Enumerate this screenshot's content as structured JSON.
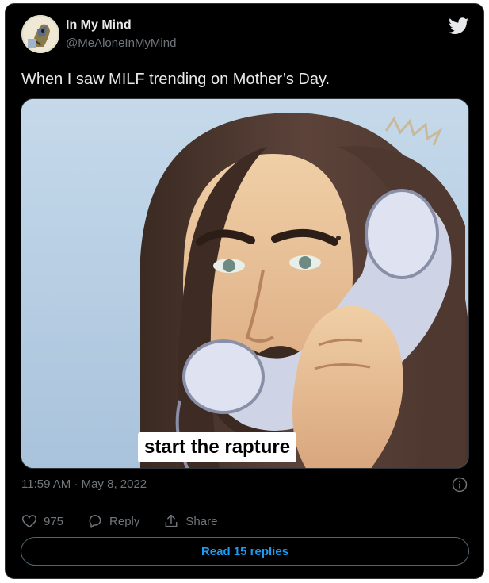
{
  "author": {
    "display_name": "In My Mind",
    "handle": "@MeAloneInMyMind",
    "avatar_icon": "cartoon-avatar"
  },
  "tweet": {
    "text": "When I saw MILF trending on Mother’s Day.",
    "media_caption": "start the rapture",
    "timestamp": "11:59 AM · May 8, 2022"
  },
  "actions": {
    "like_count": "975",
    "reply_label": "Reply",
    "share_label": "Share"
  },
  "read_replies_label": "Read 15 replies",
  "colors": {
    "background": "#000000",
    "primary_text": "#e7e9ea",
    "secondary_text": "#71767b",
    "accent": "#1d9bf0",
    "border": "#2f3336"
  },
  "icons": [
    "twitter-bird-icon",
    "info-icon",
    "heart-icon",
    "reply-icon",
    "share-icon"
  ]
}
